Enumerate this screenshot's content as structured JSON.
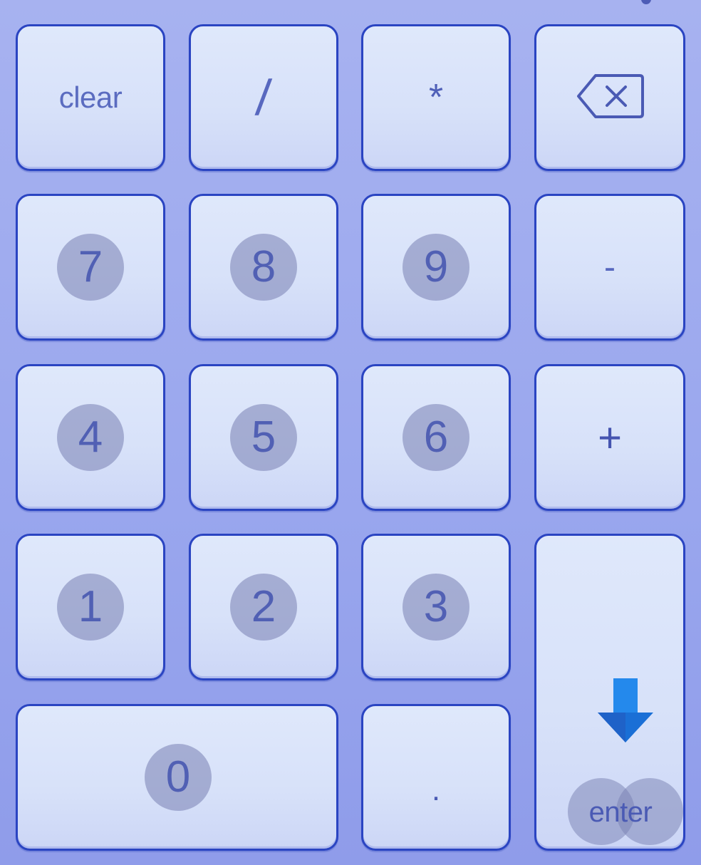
{
  "keypad": {
    "row1": {
      "clear": "clear",
      "divide": "/",
      "multiply": "*",
      "backspace_icon": "backspace-icon"
    },
    "row2": {
      "seven": "7",
      "eight": "8",
      "nine": "9",
      "minus": "-"
    },
    "row3": {
      "four": "4",
      "five": "5",
      "six": "6",
      "plus": "+"
    },
    "row4": {
      "one": "1",
      "two": "2",
      "three": "3"
    },
    "row5": {
      "zero": "0",
      "decimal": ".",
      "enter": "enter",
      "enter_icon": "arrow-down-icon"
    }
  },
  "colors": {
    "background": "#9aa7ee",
    "key_border": "#2a44c2",
    "key_face": "#dfe8fb",
    "arrow": "#1f7fe6"
  }
}
